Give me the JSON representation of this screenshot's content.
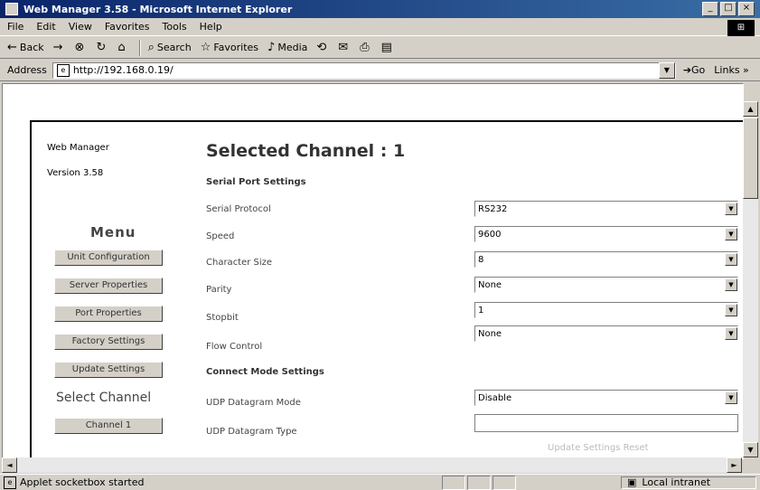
{
  "window": {
    "title": "Web Manager 3.58 - Microsoft Internet Explorer",
    "min": "_",
    "max": "□",
    "close": "×"
  },
  "menubar": {
    "items": [
      "File",
      "Edit",
      "View",
      "Favorites",
      "Tools",
      "Help"
    ]
  },
  "toolbar": {
    "back": "Back",
    "forward": "→",
    "stop": "⊗",
    "refresh": "↻",
    "home": "⌂",
    "search": "Search",
    "favorites": "Favorites",
    "media": "Media",
    "history": "⟲"
  },
  "address": {
    "label": "Address",
    "url": "http://192.168.0.19/",
    "go": "Go",
    "links": "Links »"
  },
  "sidebar": {
    "product": "Web Manager",
    "version": "Version 3.58",
    "menu_title": "Menu",
    "buttons": [
      "Unit Configuration",
      "Server Properties",
      "Port Properties",
      "Factory Settings",
      "Update Settings"
    ],
    "select_channel": "Select Channel",
    "channel_button": "Channel 1"
  },
  "main": {
    "heading": "Selected Channel : 1",
    "serial_section": "Serial Port Settings",
    "fields": [
      {
        "label": "Serial Protocol",
        "value": "RS232"
      },
      {
        "label": "Speed",
        "value": "9600"
      },
      {
        "label": "Character Size",
        "value": "8"
      },
      {
        "label": "Parity",
        "value": "None"
      },
      {
        "label": "Stopbit",
        "value": "1"
      },
      {
        "label": "Flow Control",
        "value": "None"
      }
    ],
    "connect_section": "Connect Mode Settings",
    "udp_mode_label": "UDP Datagram Mode",
    "udp_mode_value": "Disable",
    "udp_type_label": "UDP Datagram Type",
    "udp_type_value": "",
    "faded_text": "Update Settings  Reset"
  },
  "status": {
    "text": "Applet socketbox started",
    "zone": "Local intranet"
  }
}
